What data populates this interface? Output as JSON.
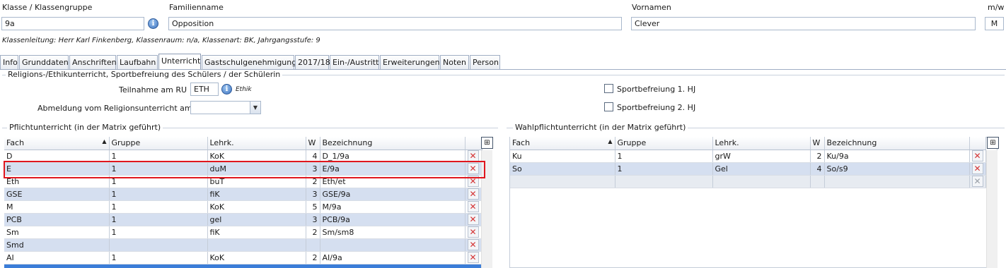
{
  "header": {
    "klasse_label": "Klasse / Klassengruppe",
    "klasse_value": "9a",
    "familienname_label": "Familienname",
    "familienname_value": "Opposition",
    "vornamen_label": "Vornamen",
    "vornamen_value": "Clever",
    "mw_label": "m/w",
    "mw_value": "M",
    "info_glyph": "i",
    "klassenleitung": "Klassenleitung: Herr Karl Finkenberg, Klassenraum: n/a, Klassenart: BK, Jahrgangsstufe: 9"
  },
  "tabs": [
    "Info",
    "Grunddaten",
    "Anschriften",
    "Laufbahn",
    "Unterricht",
    "Gastschulgenehmigung",
    "2017/18",
    "Ein-/Austritt",
    "Erweiterungen",
    "Noten",
    "Person"
  ],
  "active_tab": "Unterricht",
  "religion": {
    "group_title": "Religions-/Ethikunterricht, Sportbefreiung des Schülers / der Schülerin",
    "teilnahme_label": "Teilnahme am RU",
    "teilnahme_value": "ETH",
    "teilnahme_hint": "Ethik",
    "abmeldung_label": "Abmeldung vom Religionsunterricht am",
    "abmeldung_value": "",
    "sport1_label": "Sportbefreiung 1. HJ",
    "sport2_label": "Sportbefreiung 2. HJ"
  },
  "pflicht": {
    "group_title": "Pflichtunterricht (in der Matrix geführt)",
    "columns": [
      "Fach",
      "Gruppe",
      "Lehrk.",
      "W",
      "Bezeichnung"
    ],
    "rows": [
      {
        "fach": "D",
        "gruppe": "1",
        "lehrk": "KoK",
        "w": "4",
        "bez": "D_1/9a"
      },
      {
        "fach": "E",
        "gruppe": "1",
        "lehrk": "duM",
        "w": "3",
        "bez": "E/9a"
      },
      {
        "fach": "Eth",
        "gruppe": "1",
        "lehrk": "buT",
        "w": "2",
        "bez": "Eth/et"
      },
      {
        "fach": "GSE",
        "gruppe": "1",
        "lehrk": "fiK",
        "w": "3",
        "bez": "GSE/9a"
      },
      {
        "fach": "M",
        "gruppe": "1",
        "lehrk": "KoK",
        "w": "5",
        "bez": "M/9a"
      },
      {
        "fach": "PCB",
        "gruppe": "1",
        "lehrk": "gel",
        "w": "3",
        "bez": "PCB/9a"
      },
      {
        "fach": "Sm",
        "gruppe": "1",
        "lehrk": "fiK",
        "w": "2",
        "bez": "Sm/sm8"
      },
      {
        "fach": "Smd",
        "gruppe": "",
        "lehrk": "",
        "w": "",
        "bez": ""
      },
      {
        "fach": "AI",
        "gruppe": "1",
        "lehrk": "KoK",
        "w": "2",
        "bez": "AI/9a"
      }
    ]
  },
  "wahl": {
    "group_title": "Wahlpflichtunterricht (in der Matrix geführt)",
    "columns": [
      "Fach",
      "Gruppe",
      "Lehrk.",
      "W",
      "Bezeichnung"
    ],
    "rows": [
      {
        "fach": "Ku",
        "gruppe": "1",
        "lehrk": "grW",
        "w": "2",
        "bez": "Ku/9a"
      },
      {
        "fach": "So",
        "gruppe": "1",
        "lehrk": "Gel",
        "w": "4",
        "bez": "So/s9"
      }
    ]
  },
  "glyphs": {
    "delete": "✕",
    "sort_asc": "▲",
    "dropdown": "▼",
    "config": "⊞"
  },
  "colors": {
    "row_alt": "#d5dff0",
    "highlight_box": "#e0161e",
    "delete_icon": "#d43434"
  }
}
